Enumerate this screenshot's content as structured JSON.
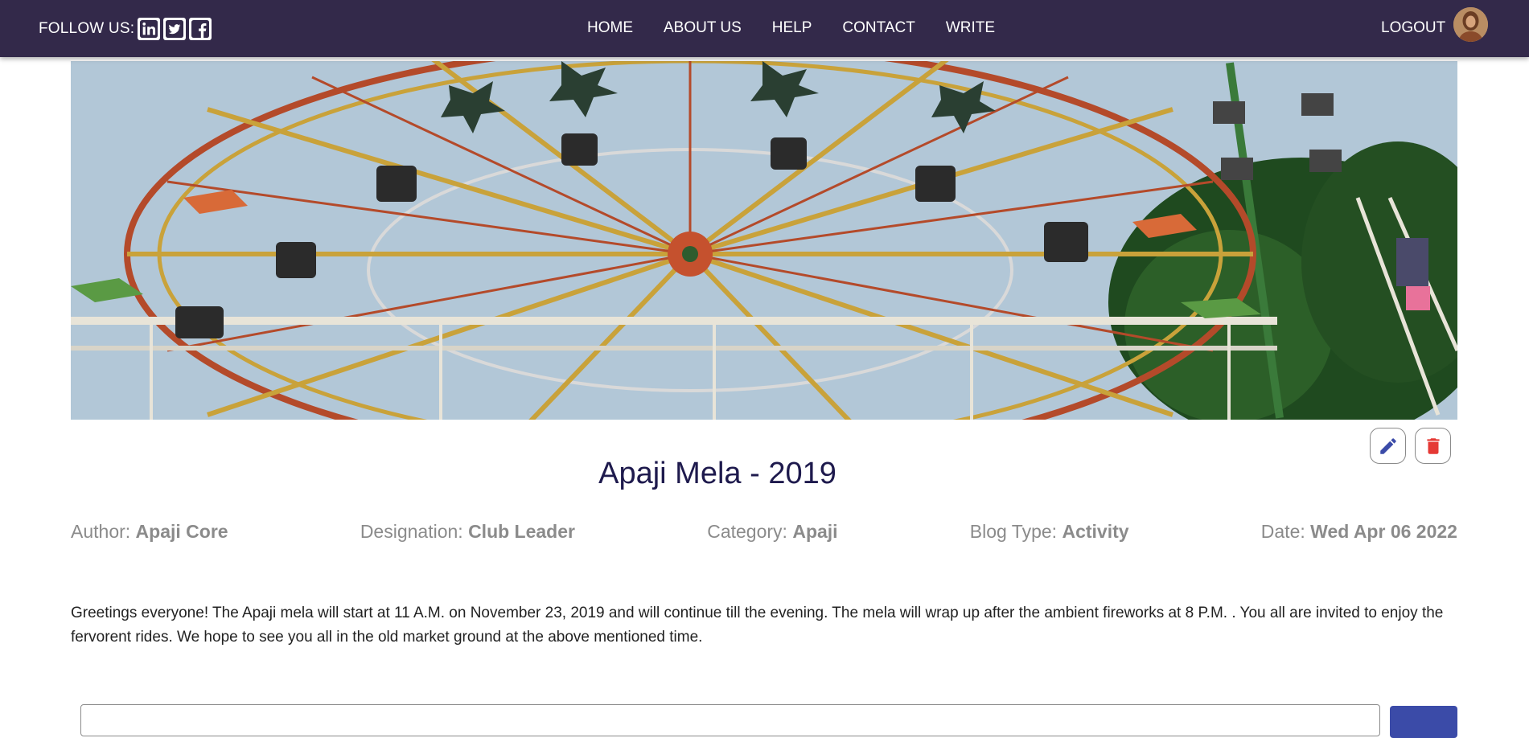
{
  "navbar": {
    "follow_label": "FOLLOW US:",
    "social_icons": [
      "linkedin-icon",
      "twitter-icon",
      "facebook-icon"
    ],
    "menu": [
      {
        "label": "HOME"
      },
      {
        "label": "ABOUT US"
      },
      {
        "label": "HELP"
      },
      {
        "label": "CONTACT"
      },
      {
        "label": "WRITE"
      }
    ],
    "logout_label": "LOGOUT",
    "background": "#33294a"
  },
  "post": {
    "title": "Apaji Mela - 2019",
    "meta": {
      "author_label": "Author:",
      "author": "Apaji Core",
      "designation_label": "Designation:",
      "designation": "Club Leader",
      "category_label": "Category:",
      "category": "Apaji",
      "blog_type_label": "Blog Type:",
      "blog_type": "Activity",
      "date_label": "Date:",
      "date": "Wed Apr 06 2022"
    },
    "content": "Greetings everyone! The Apaji mela will start at 11 A.M. on November 23, 2019 and will continue till the evening. The mela will wrap up after the ambient fireworks at 8 P.M. . You all are invited to enjoy the fervorent rides. We hope to see you all in the old market ground at the above mentioned time.",
    "actions": {
      "edit_icon": "pencil-icon",
      "delete_icon": "trash-icon",
      "edit_color": "#3b4ba8",
      "delete_color": "#e53935"
    }
  },
  "comment": {
    "button_color": "#3b4ba8"
  }
}
